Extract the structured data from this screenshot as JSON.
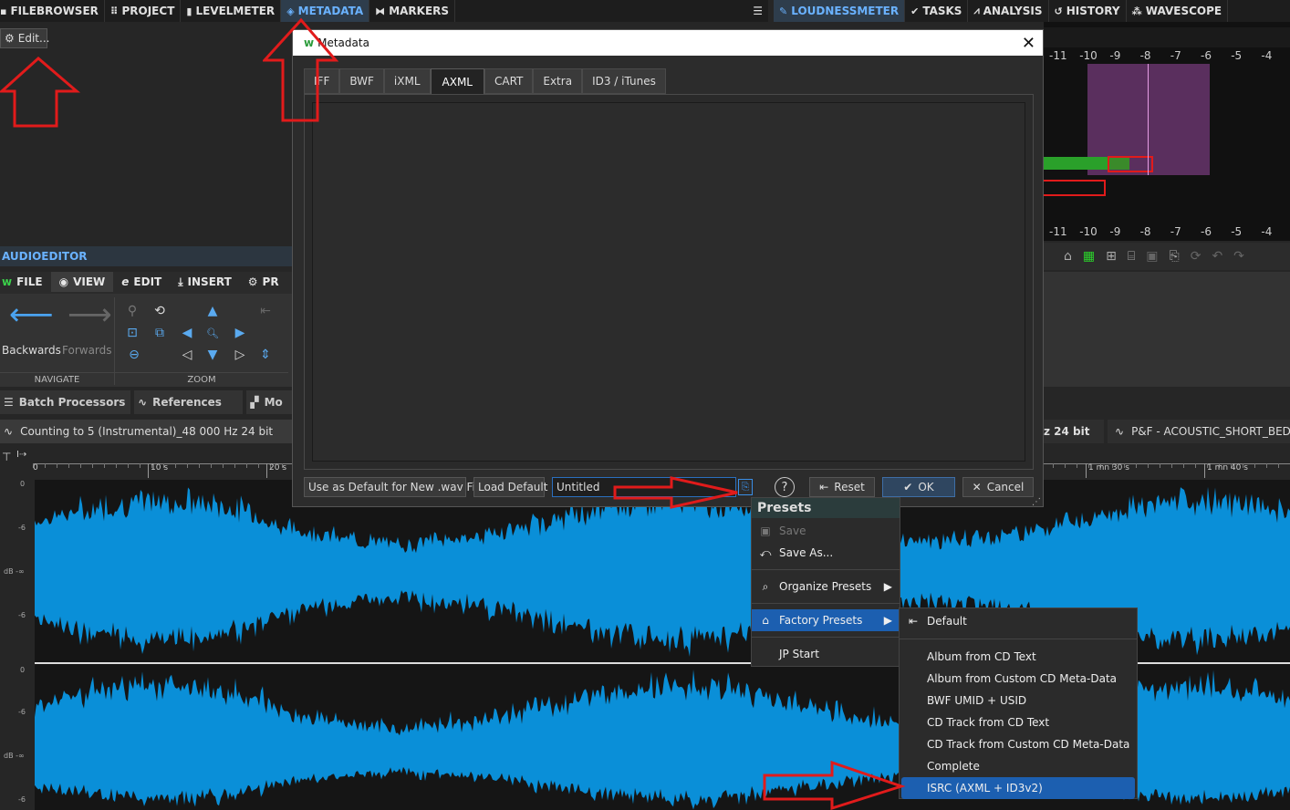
{
  "top_tabs_left": [
    {
      "label": "FILEBROWSER",
      "icon": "folder-icon"
    },
    {
      "label": "PROJECT",
      "icon": "grid-icon"
    },
    {
      "label": "LEVELMETER",
      "icon": "bars-icon"
    },
    {
      "label": "METADATA",
      "icon": "tag-icon",
      "active": true
    },
    {
      "label": "MARKERS",
      "icon": "marker-icon"
    }
  ],
  "top_tabs_right": [
    {
      "label": "LOUDNESSMETER",
      "icon": "pen-icon",
      "active": true
    },
    {
      "label": "TASKS",
      "icon": "check-icon"
    },
    {
      "label": "ANALYSIS",
      "icon": "analysis-icon"
    },
    {
      "label": "HISTORY",
      "icon": "history-icon"
    },
    {
      "label": "WAVESCOPE",
      "icon": "wave-icon"
    }
  ],
  "edit_button": "Edit...",
  "meter_scale": [
    "-11",
    "-10",
    "-9",
    "-8",
    "-7",
    "-6",
    "-5",
    "-4"
  ],
  "audioeditor_title": "AUDIOEDITOR",
  "ribbon_tabs": [
    {
      "label": "FILE",
      "icon": "wavelab-icon"
    },
    {
      "label": "VIEW",
      "icon": "eye-icon",
      "active": true
    },
    {
      "label": "EDIT",
      "icon": "edit-icon"
    },
    {
      "label": "INSERT",
      "icon": "insert-icon"
    },
    {
      "label": "PR",
      "icon": "gears-icon"
    }
  ],
  "navigate": {
    "backwards": "Backwards",
    "forwards": "Forwards",
    "group_label": "NAVIGATE"
  },
  "zoom_group_label": "ZOOM",
  "bottom_tabs": [
    {
      "label": "Batch Processors",
      "icon": "batch-icon"
    },
    {
      "label": "References",
      "icon": "wave-icon"
    },
    {
      "label": "Mo",
      "icon": "grid-icon"
    }
  ],
  "file_tab_left": "Counting to 5 (Instrumental)_48 000 Hz 24 bit",
  "file_tab_mid": "z 24 bit",
  "file_tab_right": "P&F - ACOUSTIC_SHORT_BED_",
  "ruler_labels_left": [
    "0",
    "10 s",
    "20 s"
  ],
  "ruler_labels_right": [
    "1 mn 30 s",
    "1 mn 40 s"
  ],
  "db_labels": [
    "0",
    "-6",
    "dB -∞",
    "-6",
    "0",
    "-6",
    "dB -∞",
    "-6"
  ],
  "dialog": {
    "title": "Metadata",
    "tabs": [
      "IFF",
      "BWF",
      "iXML",
      "AXML",
      "CART",
      "Extra",
      "ID3 / iTunes"
    ],
    "active_tab": "AXML",
    "buttons": {
      "use_default": "Use as Default for New .wav Files",
      "load_default": "Load Default",
      "preset_name": "Untitled",
      "reset": "Reset",
      "ok": "OK",
      "cancel": "Cancel"
    }
  },
  "presets_menu": {
    "title": "Presets",
    "items": [
      {
        "label": "Save",
        "disabled": true
      },
      {
        "label": "Save As..."
      },
      {
        "label": "Organize Presets"
      },
      {
        "label": "Factory Presets"
      },
      {
        "label": "JP Start"
      }
    ]
  },
  "factory_menu": {
    "items": [
      "Default",
      "Album from CD Text",
      "Album from Custom CD Meta-Data",
      "BWF UMID + USID",
      "CD Track from CD Text",
      "CD Track from Custom CD Meta-Data",
      "Complete",
      "ISRC (AXML + ID3v2)"
    ],
    "highlighted": "ISRC (AXML + ID3v2)"
  },
  "colors": {
    "accent": "#6ab2ff",
    "waveform": "#0a8fd8",
    "highlight": "#1c5fb0",
    "arrow": "#e11b1b"
  }
}
